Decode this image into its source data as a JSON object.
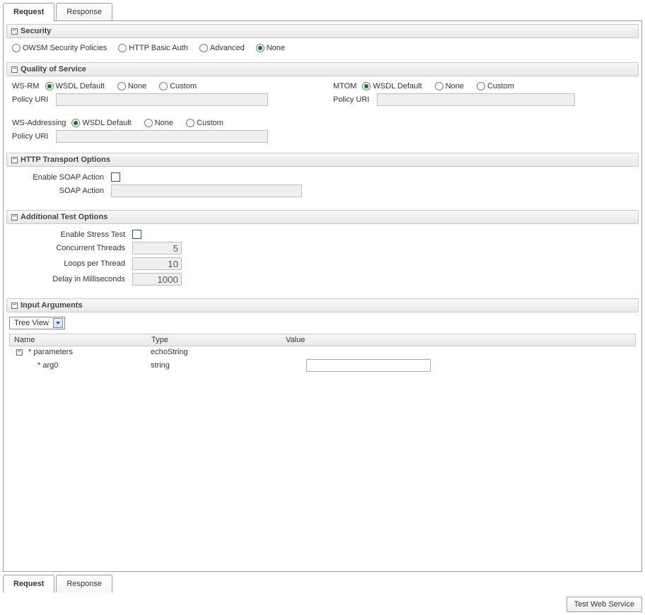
{
  "tabs": {
    "request": "Request",
    "response": "Response"
  },
  "sections": {
    "security": {
      "title": "Security",
      "options": {
        "owsm": "OWSM Security Policies",
        "basic": "HTTP Basic Auth",
        "advanced": "Advanced",
        "none": "None"
      }
    },
    "qos": {
      "title": "Quality of Service",
      "wsrm_label": "WS-RM",
      "mtom_label": "MTOM",
      "wsaddr_label": "WS-Addressing",
      "policy_uri_label": "Policy URI",
      "radio": {
        "wsdl": "WSDL Default",
        "none": "None",
        "custom": "Custom"
      }
    },
    "http": {
      "title": "HTTP Transport Options",
      "enable_soap_label": "Enable SOAP Action",
      "soap_action_label": "SOAP Action"
    },
    "test_opts": {
      "title": "Additional Test Options",
      "enable_stress_label": "Enable Stress Test",
      "concurrent_label": "Concurrent Threads",
      "concurrent_value": "5",
      "loops_label": "Loops per Thread",
      "loops_value": "10",
      "delay_label": "Delay in Milliseconds",
      "delay_value": "1000"
    },
    "input_args": {
      "title": "Input Arguments",
      "view_mode": "Tree View",
      "cols": {
        "name": "Name",
        "type": "Type",
        "value": "Value"
      },
      "rows": {
        "r0": {
          "name": "* parameters",
          "type": "echoString"
        },
        "r1": {
          "name": "* arg0",
          "type": "string"
        }
      }
    }
  },
  "footer": {
    "test_btn": "Test Web Service"
  }
}
